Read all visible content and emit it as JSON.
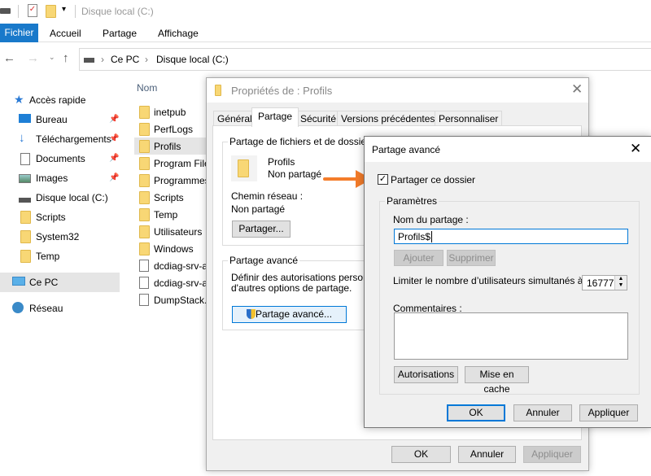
{
  "explorer": {
    "title": "Disque local (C:)",
    "ribbon_tabs": [
      "Fichier",
      "Accueil",
      "Partage",
      "Affichage"
    ],
    "breadcrumb": [
      "Ce PC",
      "Disque local (C:)"
    ],
    "column_header": "Nom",
    "sidebar": {
      "quick_access": "Accès rapide",
      "items": [
        "Bureau",
        "Téléchargements",
        "Documents",
        "Images",
        "Disque local (C:)",
        "Scripts",
        "System32",
        "Temp"
      ],
      "this_pc": "Ce PC",
      "network": "Réseau"
    },
    "files": [
      {
        "name": "inetpub",
        "type": "folder"
      },
      {
        "name": "PerfLogs",
        "type": "folder"
      },
      {
        "name": "Profils",
        "type": "folder",
        "selected": true
      },
      {
        "name": "Program Files",
        "type": "folder"
      },
      {
        "name": "Programmes",
        "type": "folder"
      },
      {
        "name": "Scripts",
        "type": "folder"
      },
      {
        "name": "Temp",
        "type": "folder"
      },
      {
        "name": "Utilisateurs",
        "type": "folder"
      },
      {
        "name": "Windows",
        "type": "folder"
      },
      {
        "name": "dcdiag-srv-a",
        "type": "file"
      },
      {
        "name": "dcdiag-srv-a",
        "type": "file"
      },
      {
        "name": "DumpStack.",
        "type": "file"
      }
    ]
  },
  "properties": {
    "title": "Propriétés de : Profils",
    "tabs": [
      "Général",
      "Partage",
      "Sécurité",
      "Versions précédentes",
      "Personnaliser"
    ],
    "share_group_label": "Partage de fichiers et de dossiers en",
    "folder_name": "Profils",
    "folder_status": "Non partagé",
    "network_path_label": "Chemin réseau :",
    "network_path_value": "Non partagé",
    "share_button": "Partager...",
    "advanced_group_label": "Partage avancé",
    "advanced_desc_1": "Définir des autorisations personnalis",
    "advanced_desc_2": "d'autres options de partage.",
    "advanced_button": "Partage avancé...",
    "ok": "OK",
    "cancel": "Annuler",
    "apply": "Appliquer"
  },
  "advanced": {
    "title": "Partage avancé",
    "share_checkbox": "Partager ce dossier",
    "share_checked": true,
    "params_label": "Paramètres",
    "share_name_label": "Nom du partage :",
    "share_name_value": "Profils$",
    "add": "Ajouter",
    "remove": "Supprimer",
    "limit_label": "Limiter le nombre d’utilisateurs simultanés à :",
    "limit_value": "16777",
    "comments_label": "Commentaires :",
    "comments_value": "",
    "permissions": "Autorisations",
    "caching": "Mise en cache",
    "ok": "OK",
    "cancel": "Annuler",
    "apply": "Appliquer"
  },
  "colors": {
    "accent": "#0078d7",
    "arrow": "#f47c2a",
    "selection": "#e5e5e5"
  }
}
